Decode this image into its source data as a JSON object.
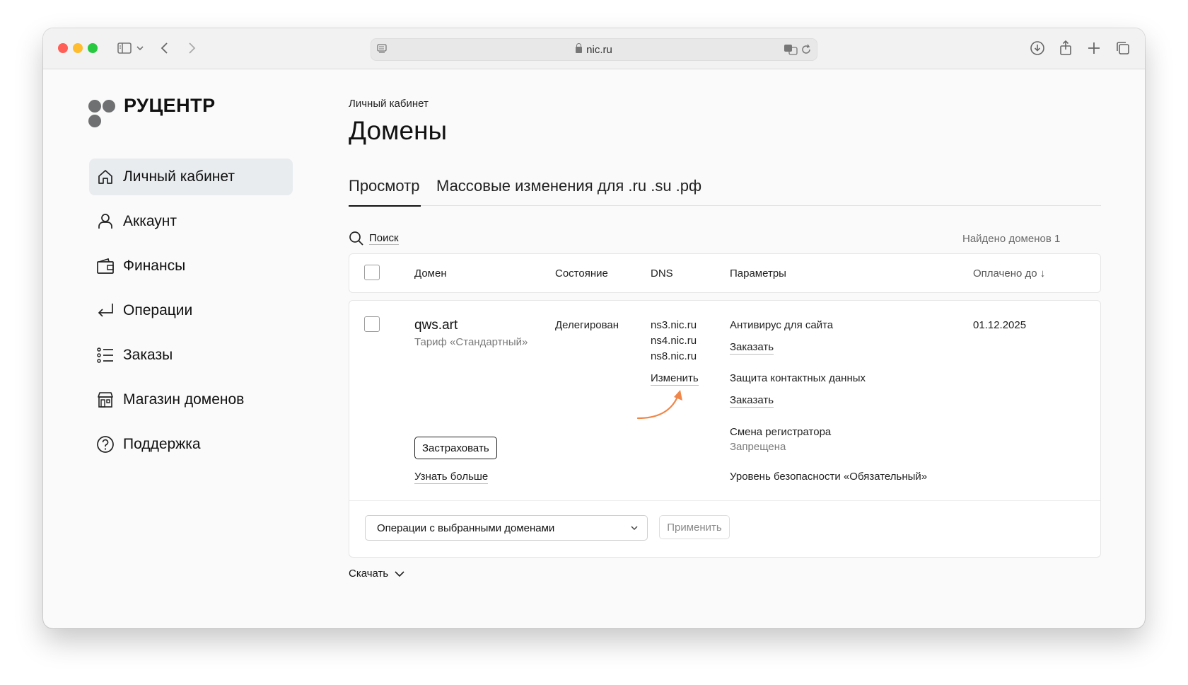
{
  "browser": {
    "url": "nic.ru"
  },
  "brand": {
    "name": "РУЦЕНТР",
    "logo_color": "#6f7072"
  },
  "sidebar": {
    "items": [
      {
        "label": "Личный кабинет",
        "icon": "home-icon",
        "active": true
      },
      {
        "label": "Аккаунт",
        "icon": "user-icon",
        "active": false
      },
      {
        "label": "Финансы",
        "icon": "wallet-icon",
        "active": false
      },
      {
        "label": "Операции",
        "icon": "return-arrow-icon",
        "active": false
      },
      {
        "label": "Заказы",
        "icon": "list-icon",
        "active": false
      },
      {
        "label": "Магазин доменов",
        "icon": "store-icon",
        "active": false
      },
      {
        "label": "Поддержка",
        "icon": "help-icon",
        "active": false
      }
    ]
  },
  "main": {
    "breadcrumb": "Личный кабинет",
    "title": "Домены",
    "tabs": [
      {
        "label": "Просмотр",
        "active": true
      },
      {
        "label": "Массовые изменения для .ru .su .рф",
        "active": false
      }
    ],
    "search_label": "Поиск",
    "found_text": "Найдено доменов 1",
    "table": {
      "headers": {
        "domain": "Домен",
        "state": "Состояние",
        "dns": "DNS",
        "params": "Параметры",
        "paid_until": "Оплачено до ↓"
      },
      "row": {
        "domain": "qws.art",
        "tariff": "Тариф «Стандартный»",
        "state": "Делегирован",
        "dns_servers": [
          "ns3.nic.ru",
          "ns4.nic.ru",
          "ns8.nic.ru"
        ],
        "dns_change": "Изменить",
        "insure_button": "Застраховать",
        "learn_more": "Узнать больше",
        "params": {
          "antivirus": "Антивирус для сайта",
          "antivirus_action": "Заказать",
          "contact_protection": "Защита контактных данных",
          "contact_action": "Заказать",
          "registrar_change": "Смена регистратора",
          "registrar_status": "Запрещена",
          "security_level": "Уровень безопасности «Обязательный»"
        },
        "paid_until": "01.12.2025"
      }
    },
    "bulk": {
      "select_label": "Операции с выбранными доменами",
      "apply_label": "Применить"
    },
    "download_label": "Скачать"
  },
  "annotation": {
    "arrow_color": "#f0874a"
  }
}
